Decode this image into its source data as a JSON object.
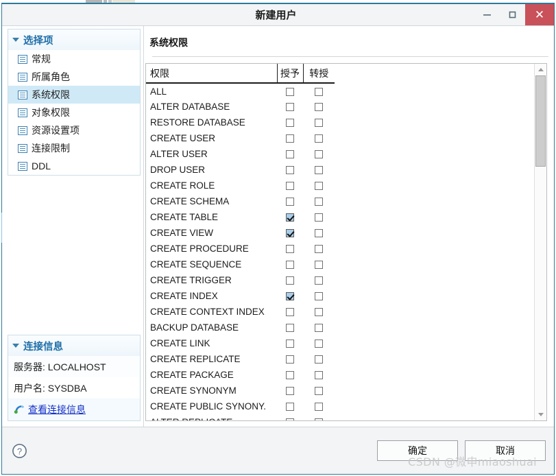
{
  "window": {
    "title": "新建用户",
    "controls": {
      "minimize": "minimize-icon",
      "maximize": "maximize-icon",
      "close": "✕"
    }
  },
  "sidebar": {
    "options_panel": {
      "header": "选择项",
      "items": [
        {
          "label": "常规",
          "selected": false
        },
        {
          "label": "所属角色",
          "selected": false
        },
        {
          "label": "系统权限",
          "selected": true
        },
        {
          "label": "对象权限",
          "selected": false
        },
        {
          "label": "资源设置项",
          "selected": false
        },
        {
          "label": "连接限制",
          "selected": false
        },
        {
          "label": "DDL",
          "selected": false
        }
      ]
    },
    "connection_panel": {
      "header": "连接信息",
      "server_row": "服务器: LOCALHOST",
      "user_row": "用户名: SYSDBA",
      "link_label": "查看连接信息"
    }
  },
  "main": {
    "title": "系统权限",
    "table": {
      "columns": [
        "权限",
        "授予",
        "转授"
      ],
      "rows": [
        {
          "name": "ALL",
          "grant": false,
          "admin": false
        },
        {
          "name": "ALTER DATABASE",
          "grant": false,
          "admin": false
        },
        {
          "name": "RESTORE DATABASE",
          "grant": false,
          "admin": false
        },
        {
          "name": "CREATE USER",
          "grant": false,
          "admin": false
        },
        {
          "name": "ALTER USER",
          "grant": false,
          "admin": false
        },
        {
          "name": "DROP USER",
          "grant": false,
          "admin": false
        },
        {
          "name": "CREATE ROLE",
          "grant": false,
          "admin": false
        },
        {
          "name": "CREATE SCHEMA",
          "grant": false,
          "admin": false
        },
        {
          "name": "CREATE TABLE",
          "grant": true,
          "admin": false
        },
        {
          "name": "CREATE VIEW",
          "grant": true,
          "admin": false
        },
        {
          "name": "CREATE PROCEDURE",
          "grant": false,
          "admin": false
        },
        {
          "name": "CREATE SEQUENCE",
          "grant": false,
          "admin": false
        },
        {
          "name": "CREATE TRIGGER",
          "grant": false,
          "admin": false
        },
        {
          "name": "CREATE INDEX",
          "grant": true,
          "admin": false
        },
        {
          "name": "CREATE CONTEXT INDEX",
          "grant": false,
          "admin": false
        },
        {
          "name": "BACKUP DATABASE",
          "grant": false,
          "admin": false
        },
        {
          "name": "CREATE LINK",
          "grant": false,
          "admin": false
        },
        {
          "name": "CREATE REPLICATE",
          "grant": false,
          "admin": false
        },
        {
          "name": "CREATE PACKAGE",
          "grant": false,
          "admin": false
        },
        {
          "name": "CREATE SYNONYM",
          "grant": false,
          "admin": false
        },
        {
          "name": "CREATE PUBLIC SYNONY.",
          "grant": false,
          "admin": false
        },
        {
          "name": "ALTER REPLICATE",
          "grant": false,
          "admin": false
        }
      ]
    }
  },
  "footer": {
    "help_icon": "question-mark-icon",
    "ok_label": "确定",
    "cancel_label": "取消"
  },
  "watermark": "CSDN @微申miaoshuai",
  "colors": {
    "accent": "#2b7a99",
    "selection": "#cfe9f7",
    "close_button": "#c9515a",
    "link": "#1430c8",
    "checkbox_checked": "#aaceea"
  }
}
